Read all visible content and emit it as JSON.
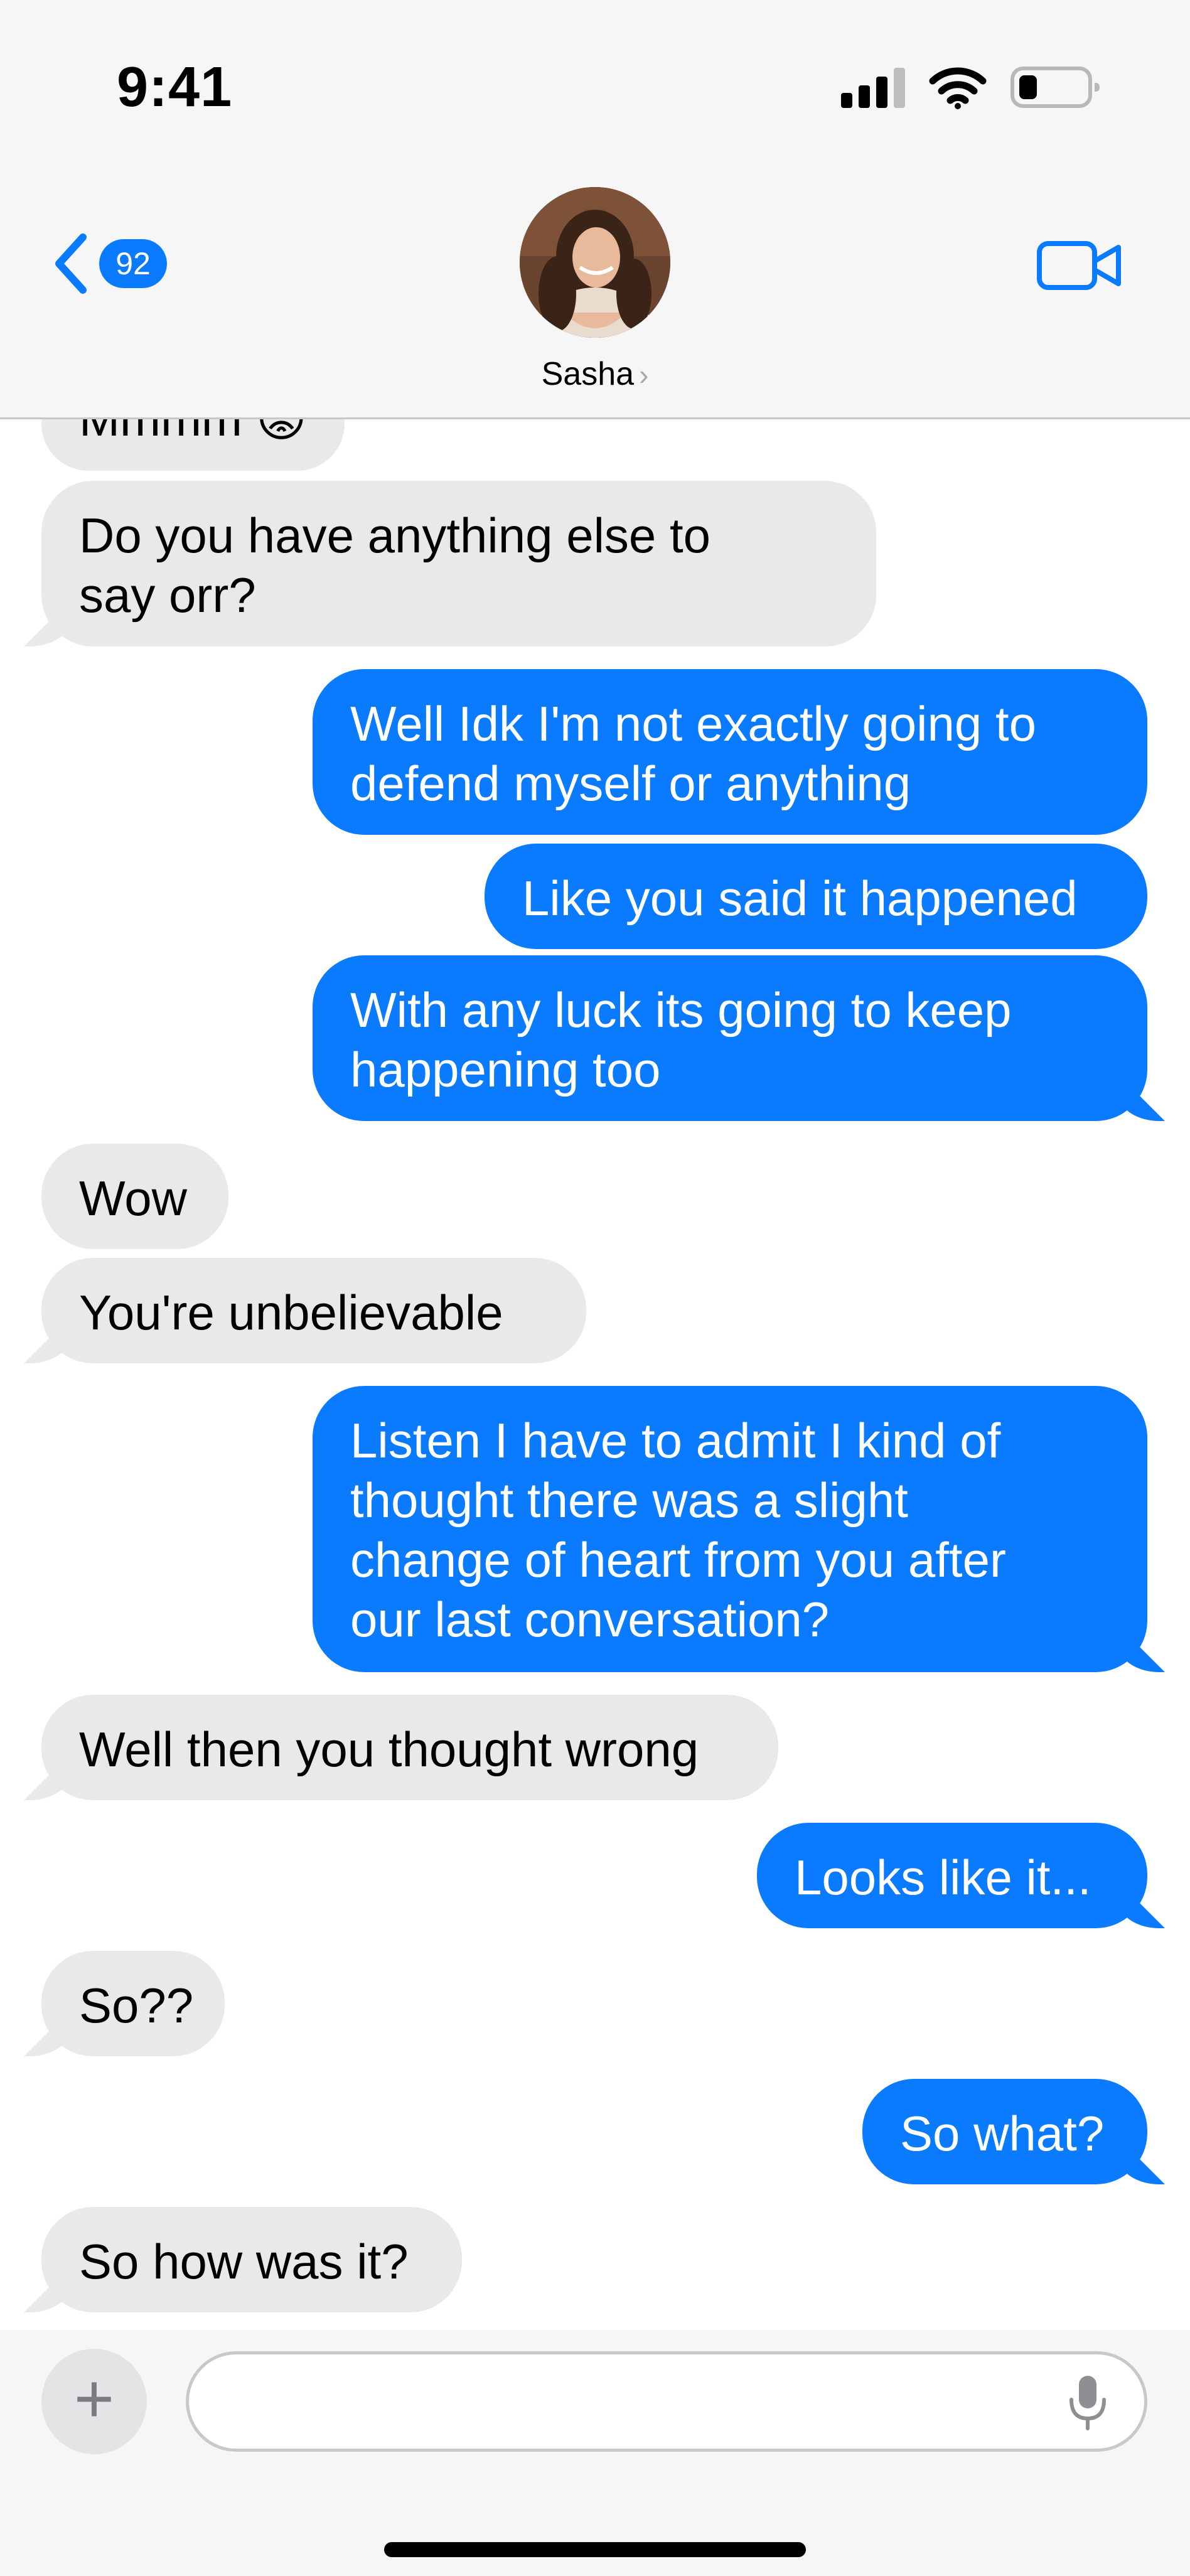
{
  "status_bar": {
    "time": "9:41"
  },
  "header": {
    "back_badge_count": "92",
    "contact_name": "Sasha",
    "contact_chevron": "›"
  },
  "messages": [
    {
      "from": "them",
      "text": "Mmmm 😡",
      "partial": true
    },
    {
      "from": "them",
      "lines": [
        "Do you have anything else to",
        "say orr?"
      ]
    },
    {
      "from": "me",
      "lines": [
        "Well Idk I'm not exactly going to",
        "defend myself or anything"
      ]
    },
    {
      "from": "me",
      "lines": [
        "Like you said it happened"
      ]
    },
    {
      "from": "me",
      "lines": [
        "With any luck its going to keep",
        "happening too"
      ]
    },
    {
      "from": "them",
      "lines": [
        "Wow"
      ]
    },
    {
      "from": "them",
      "lines": [
        "You're unbelievable"
      ]
    },
    {
      "from": "me",
      "lines": [
        "Listen I have to admit I kind of",
        "thought there was a slight",
        "change of heart from you after",
        "our last conversation?"
      ]
    },
    {
      "from": "them",
      "lines": [
        "Well then you thought wrong"
      ]
    },
    {
      "from": "me",
      "lines": [
        "Looks like it..."
      ]
    },
    {
      "from": "them",
      "lines": [
        "So??"
      ]
    },
    {
      "from": "me",
      "lines": [
        "So what?"
      ]
    },
    {
      "from": "them",
      "lines": [
        "So how was it?"
      ]
    }
  ],
  "input": {
    "placeholder": "",
    "plus_label": "+"
  },
  "colors": {
    "sent": "#0a7aff",
    "received": "#e9e9eb",
    "header_bg": "#f6f6f6"
  },
  "icons": [
    "signal-icon",
    "wifi-icon",
    "battery-icon",
    "back-chevron-icon",
    "video-camera-icon",
    "plus-icon",
    "microphone-icon"
  ]
}
